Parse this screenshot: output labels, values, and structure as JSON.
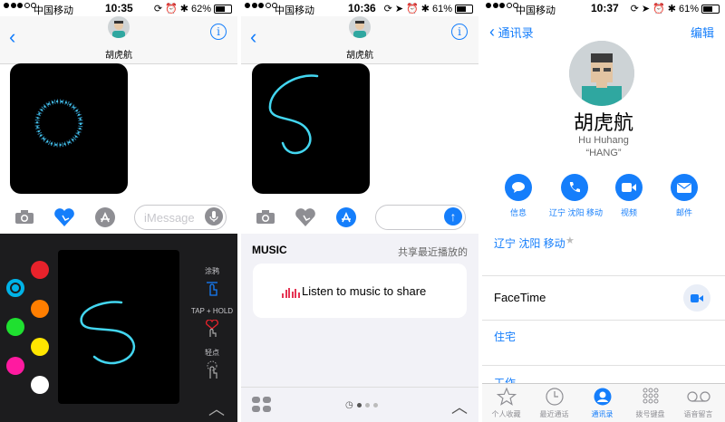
{
  "panel1": {
    "status": {
      "carrier": "中国移动",
      "time": "10:35",
      "battery": "62%",
      "battery_level": 0.62
    },
    "contact_name": "胡虎航",
    "composer_placeholder": "iMessage",
    "digital_touch": {
      "colors": [
        "#e8222b",
        "#00b3e8",
        "#ff7e00",
        "#1fe030",
        "#ffe600",
        "#ff1aa0",
        "#ffffff"
      ],
      "selected_color": "#00b3e8",
      "gesture_tap": "涂鸦",
      "gesture_hold": "TAP + HOLD",
      "gesture_click": "轻点"
    }
  },
  "panel2": {
    "status": {
      "carrier": "中国移动",
      "time": "10:36",
      "battery": "61%",
      "battery_level": 0.61
    },
    "contact_name": "胡虎航",
    "music": {
      "brand": "MUSIC",
      "share_recent": "共享最近播放的",
      "card_text": "Listen to music to share"
    }
  },
  "panel3": {
    "status": {
      "carrier": "中国移动",
      "time": "10:37",
      "battery": "61%",
      "battery_level": 0.61
    },
    "nav": {
      "back_label": "通讯录",
      "edit_label": "编辑"
    },
    "contact": {
      "name": "胡虎航",
      "pinyin": "Hu Huhang",
      "nickname": "“HANG”"
    },
    "actions": [
      {
        "label": "信息",
        "icon": "message-icon"
      },
      {
        "label": "辽宁 沈阳 移动",
        "icon": "phone-icon"
      },
      {
        "label": "视频",
        "icon": "video-icon"
      },
      {
        "label": "邮件",
        "icon": "mail-icon"
      }
    ],
    "rows": {
      "phone_label": "辽宁 沈阳 移动",
      "facetime": "FaceTime",
      "home": "住宅",
      "work": "工作"
    },
    "tabs": [
      {
        "label": "个人收藏",
        "icon": "star-icon"
      },
      {
        "label": "最近通话",
        "icon": "clock-icon"
      },
      {
        "label": "通讯录",
        "icon": "contacts-icon",
        "active": true
      },
      {
        "label": "拨号键盘",
        "icon": "keypad-icon"
      },
      {
        "label": "语音留言",
        "icon": "voicemail-icon"
      }
    ]
  },
  "colors": {
    "accent": "#157efb",
    "ink": "#43d6f0"
  }
}
